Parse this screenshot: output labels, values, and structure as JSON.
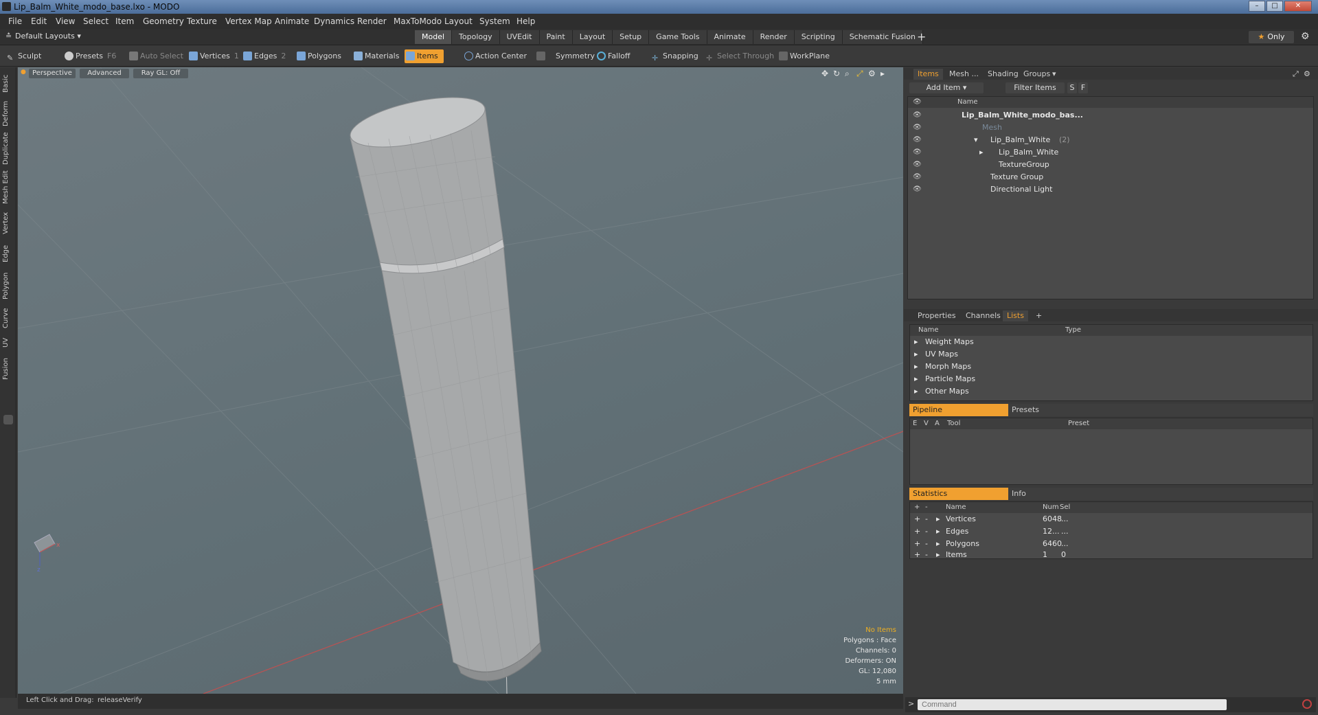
{
  "window": {
    "title": "Lip_Balm_White_modo_base.lxo - MODO"
  },
  "menu": [
    "File",
    "Edit",
    "View",
    "Select",
    "Item",
    "Geometry",
    "Texture",
    "Vertex Map",
    "Animate",
    "Dynamics",
    "Render",
    "MaxToModo",
    "Layout",
    "System",
    "Help"
  ],
  "layout_dropdown": "Default Layouts",
  "tabs": [
    "Model",
    "Topology",
    "UVEdit",
    "Paint",
    "Layout",
    "Setup",
    "Game Tools",
    "Animate",
    "Render",
    "Scripting",
    "Schematic Fusion"
  ],
  "active_tab": "Model",
  "only_label": "Only",
  "toolbar": {
    "sculpt": "Sculpt",
    "presets": "Presets",
    "presets_key": "F6",
    "auto_select": "Auto Select",
    "vertices": "Vertices",
    "vertices_count": "1",
    "edges": "Edges",
    "edges_count": "2",
    "polygons": "Polygons",
    "materials": "Materials",
    "items": "Items",
    "action_center": "Action Center",
    "symmetry": "Symmetry",
    "falloff": "Falloff",
    "snapping": "Snapping",
    "select_through": "Select Through",
    "workplane": "WorkPlane"
  },
  "left_tabs": [
    "Basic",
    "Deform",
    "Duplicate",
    "Mesh Edit",
    "Vertex",
    "Edge",
    "Polygon",
    "Curve",
    "UV",
    "Fusion"
  ],
  "viewport": {
    "perspective": "Perspective",
    "advanced": "Advanced",
    "raygl": "Ray GL: Off",
    "info": {
      "no_items": "No Items",
      "polygons": "Polygons : Face",
      "channels": "Channels: 0",
      "deformers": "Deformers: ON",
      "gl": "GL: 12,080",
      "scale": "5 mm"
    }
  },
  "status": {
    "hint": "Left Click and Drag:",
    "action": "releaseVerify"
  },
  "items_panel": {
    "tabs": [
      "Items",
      "Mesh ...",
      "Shading",
      "Groups"
    ],
    "add_item": "Add Item",
    "filter": "Filter Items",
    "s": "S",
    "f": "F",
    "name_header": "Name",
    "tree": [
      {
        "label": "Lip_Balm_White_modo_bas...",
        "indent": 0
      },
      {
        "label": "Mesh",
        "indent": 1
      },
      {
        "label": "Lip_Balm_White",
        "suffix": "(2)",
        "indent": 1
      },
      {
        "label": "Lip_Balm_White",
        "indent": 2
      },
      {
        "label": "TextureGroup",
        "indent": 2
      },
      {
        "label": "Texture Group",
        "indent": 1
      },
      {
        "label": "Directional Light",
        "indent": 1
      }
    ]
  },
  "props_panel": {
    "tabs": [
      "Properties",
      "Channels",
      "Lists"
    ],
    "name_header": "Name",
    "type_header": "Type",
    "lists": [
      "Weight Maps",
      "UV Maps",
      "Morph Maps",
      "Particle Maps",
      "Other Maps"
    ]
  },
  "pipeline_panel": {
    "tabs": [
      "Pipeline",
      "Presets"
    ],
    "cols": [
      "E",
      "V",
      "A",
      "Tool",
      "Preset"
    ]
  },
  "stats_panel": {
    "tabs": [
      "Statistics",
      "Info"
    ],
    "cols": [
      "Name",
      "Num",
      "Sel"
    ],
    "rows": [
      {
        "name": "Vertices",
        "num": "6048",
        "sel": "..."
      },
      {
        "name": "Edges",
        "num": "12...",
        "sel": "..."
      },
      {
        "name": "Polygons",
        "num": "6460",
        "sel": "..."
      },
      {
        "name": "Items",
        "num": "1",
        "sel": "0"
      }
    ]
  },
  "command": {
    "placeholder": "Command"
  }
}
